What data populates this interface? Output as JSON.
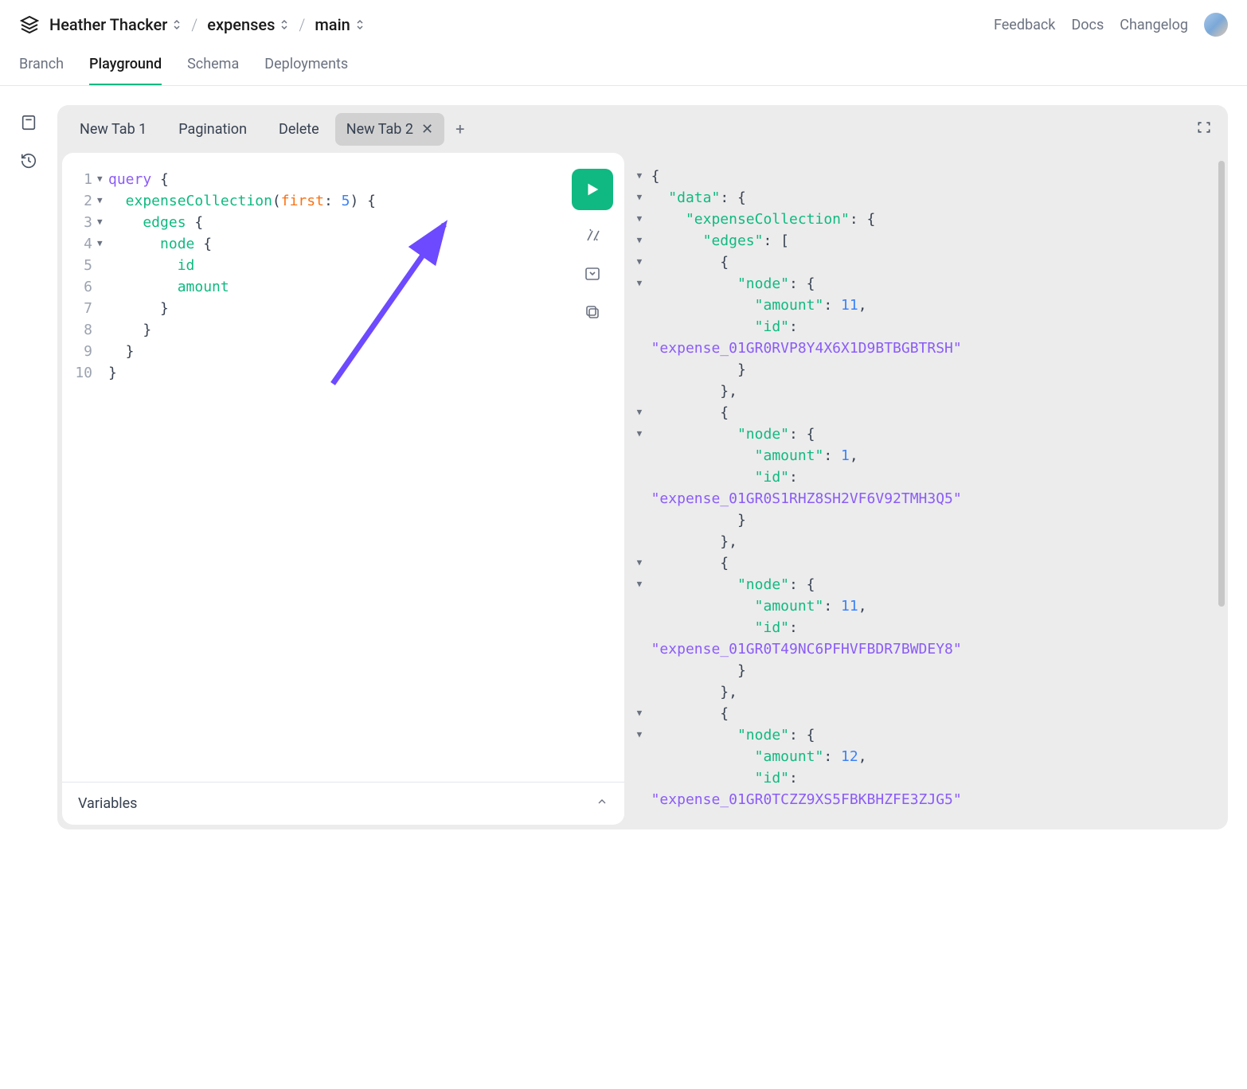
{
  "breadcrumb": {
    "owner": "Heather Thacker",
    "project": "expenses",
    "branch": "main"
  },
  "header_links": {
    "feedback": "Feedback",
    "docs": "Docs",
    "changelog": "Changelog"
  },
  "nav": {
    "branch": "Branch",
    "playground": "Playground",
    "schema": "Schema",
    "deployments": "Deployments"
  },
  "tabs": {
    "tab1": "New Tab 1",
    "tab2": "Pagination",
    "tab3": "Delete",
    "tab4": "New Tab 2"
  },
  "query_code": {
    "l1": {
      "num": "1",
      "a": "query",
      "b": " {"
    },
    "l2": {
      "num": "2",
      "a": "  expenseCollection",
      "b": "(",
      "c": "first",
      "d": ": ",
      "e": "5",
      "f": ")",
      "g": " {"
    },
    "l3": {
      "num": "3",
      "a": "    edges",
      "b": " {"
    },
    "l4": {
      "num": "4",
      "a": "      node",
      "b": " {"
    },
    "l5": {
      "num": "5",
      "a": "        id"
    },
    "l6": {
      "num": "6",
      "a": "        amount"
    },
    "l7": {
      "num": "7",
      "a": "      }"
    },
    "l8": {
      "num": "8",
      "a": "    }"
    },
    "l9": {
      "num": "9",
      "a": "  }"
    },
    "l10": {
      "num": "10",
      "a": "}"
    }
  },
  "variables_label": "Variables",
  "result": {
    "data_key": "\"data\"",
    "expenseCollection_key": "\"expenseCollection\"",
    "edges_key": "\"edges\"",
    "node_key": "\"node\"",
    "amount_key": "\"amount\"",
    "id_key": "\"id\"",
    "edge1_id": "\"expense_01GR0RVP8Y4X6X1D9BTBGBTRSH\"",
    "edge1_amount": "11",
    "edge2_id": "\"expense_01GR0S1RHZ8SH2VF6V92TMH3Q5\"",
    "edge2_amount": "1",
    "edge3_id": "\"expense_01GR0T49NC6PFHVFBDR7BWDEY8\"",
    "edge3_amount": "11",
    "edge4_id": "\"expense_01GR0TCZZ9XS5FBKBHZFE3ZJG5\"",
    "edge4_amount": "12"
  }
}
